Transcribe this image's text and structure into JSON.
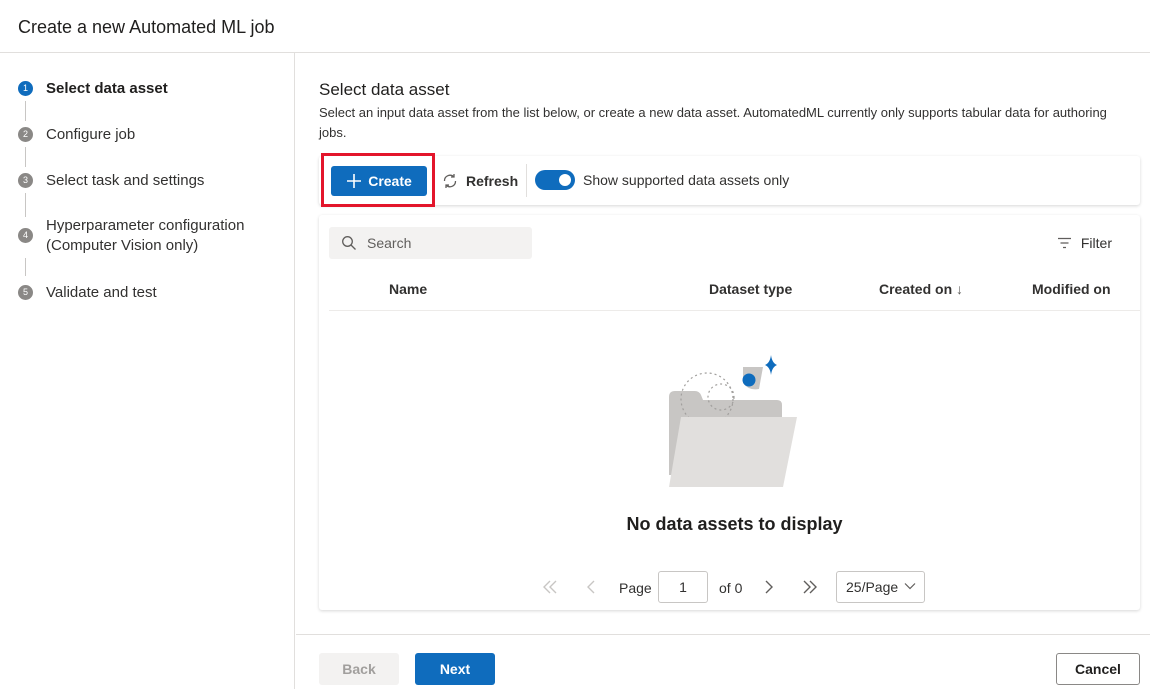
{
  "header": {
    "title": "Create a new Automated ML job"
  },
  "steps": [
    {
      "num": "1",
      "label": "Select data asset"
    },
    {
      "num": "2",
      "label": "Configure job"
    },
    {
      "num": "3",
      "label": "Select task and settings"
    },
    {
      "num": "4",
      "label_line1": "Hyperparameter configuration",
      "label_line2": "(Computer Vision only)"
    },
    {
      "num": "5",
      "label": "Validate and test"
    }
  ],
  "main": {
    "title": "Select data asset",
    "description": "Select an input data asset from the list below, or create a new data asset. AutomatedML currently only supports tabular data for authoring jobs."
  },
  "toolbar": {
    "create_label": "Create",
    "refresh_label": "Refresh",
    "toggle_label": "Show supported data assets only",
    "toggle_on": true
  },
  "table": {
    "search_placeholder": "Search",
    "filter_label": "Filter",
    "columns": [
      "Name",
      "Dataset type",
      "Created on",
      "Modified on"
    ],
    "sort_indicator": "↓",
    "empty_message": "No data assets to display"
  },
  "pager": {
    "page_label": "Page",
    "page_value": "1",
    "of_label": "of 0",
    "per_page": "25/Page"
  },
  "footer": {
    "back_label": "Back",
    "next_label": "Next",
    "cancel_label": "Cancel"
  },
  "colors": {
    "accent": "#0f6cbd",
    "highlight": "#e3152b"
  }
}
